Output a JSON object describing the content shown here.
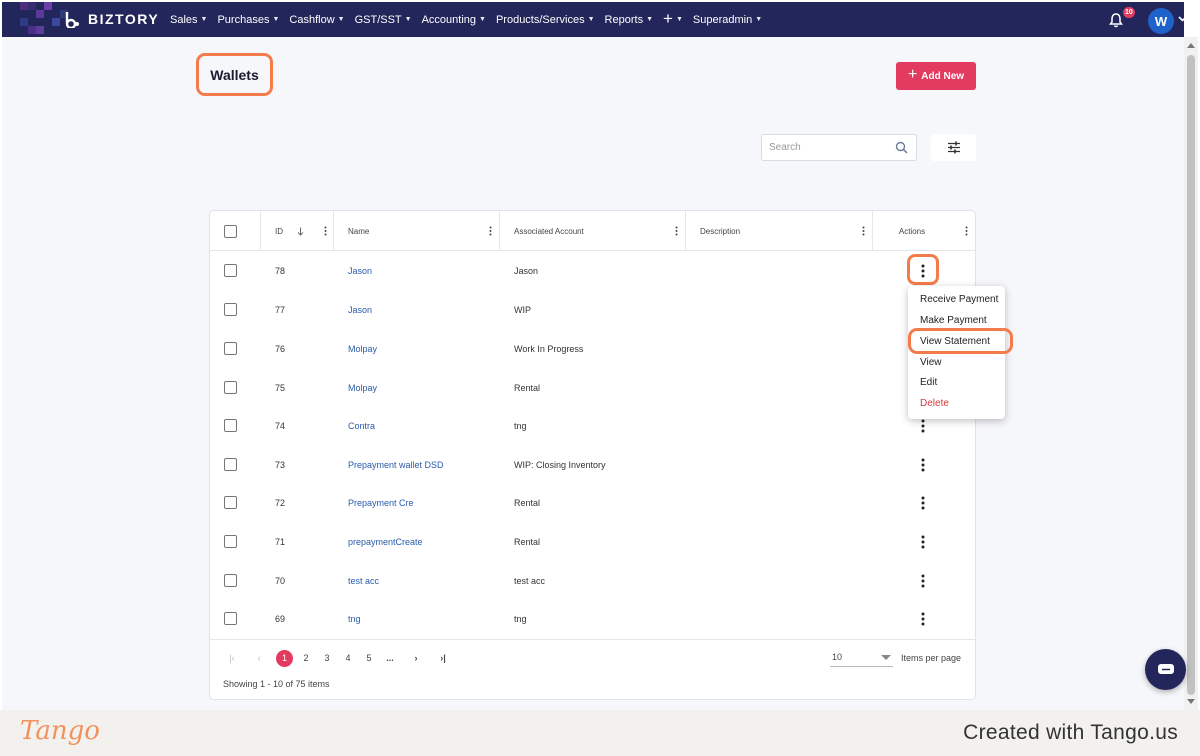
{
  "app": {
    "brand": "BIZTORY",
    "nav": [
      "Sales",
      "Purchases",
      "Cashflow",
      "GST/SST",
      "Accounting",
      "Products/Services",
      "Reports",
      "+",
      "Superadmin"
    ],
    "notification_count": "10",
    "user_initial": "W"
  },
  "page": {
    "title": "Wallets",
    "add_button": "Add New",
    "search_placeholder": "Search"
  },
  "table": {
    "columns": {
      "id": "ID",
      "name": "Name",
      "account": "Associated Account",
      "description": "Description",
      "actions": "Actions"
    },
    "rows": [
      {
        "id": "78",
        "name": "Jason",
        "account": "Jason",
        "description": ""
      },
      {
        "id": "77",
        "name": "Jason",
        "account": "WIP",
        "description": ""
      },
      {
        "id": "76",
        "name": "Molpay",
        "account": "Work In Progress",
        "description": ""
      },
      {
        "id": "75",
        "name": "Molpay",
        "account": "Rental",
        "description": ""
      },
      {
        "id": "74",
        "name": "Contra",
        "account": "tng",
        "description": ""
      },
      {
        "id": "73",
        "name": "Prepayment wallet DSD",
        "account": "WIP: Closing Inventory",
        "description": ""
      },
      {
        "id": "72",
        "name": "Prepayment Cre",
        "account": "Rental",
        "description": ""
      },
      {
        "id": "71",
        "name": "prepaymentCreate",
        "account": "Rental",
        "description": ""
      },
      {
        "id": "70",
        "name": "test acc",
        "account": "test acc",
        "description": ""
      },
      {
        "id": "69",
        "name": "tng",
        "account": "tng",
        "description": ""
      }
    ]
  },
  "action_menu": {
    "items": [
      "Receive Payment",
      "Make Payment",
      "View Statement",
      "View",
      "Edit",
      "Delete"
    ]
  },
  "pagination": {
    "pages": [
      "1",
      "2",
      "3",
      "4",
      "5",
      "..."
    ],
    "current": "1",
    "page_size": "10",
    "page_size_label": "Items per page",
    "info": "Showing 1 - 10 of 75 items"
  },
  "footer": {
    "logo": "Tango",
    "created_with": "Created with Tango.us"
  },
  "colors": {
    "nav_bg": "#23265a",
    "accent": "#e23b5f",
    "highlight": "#f47c4c",
    "link": "#2a5caa"
  }
}
